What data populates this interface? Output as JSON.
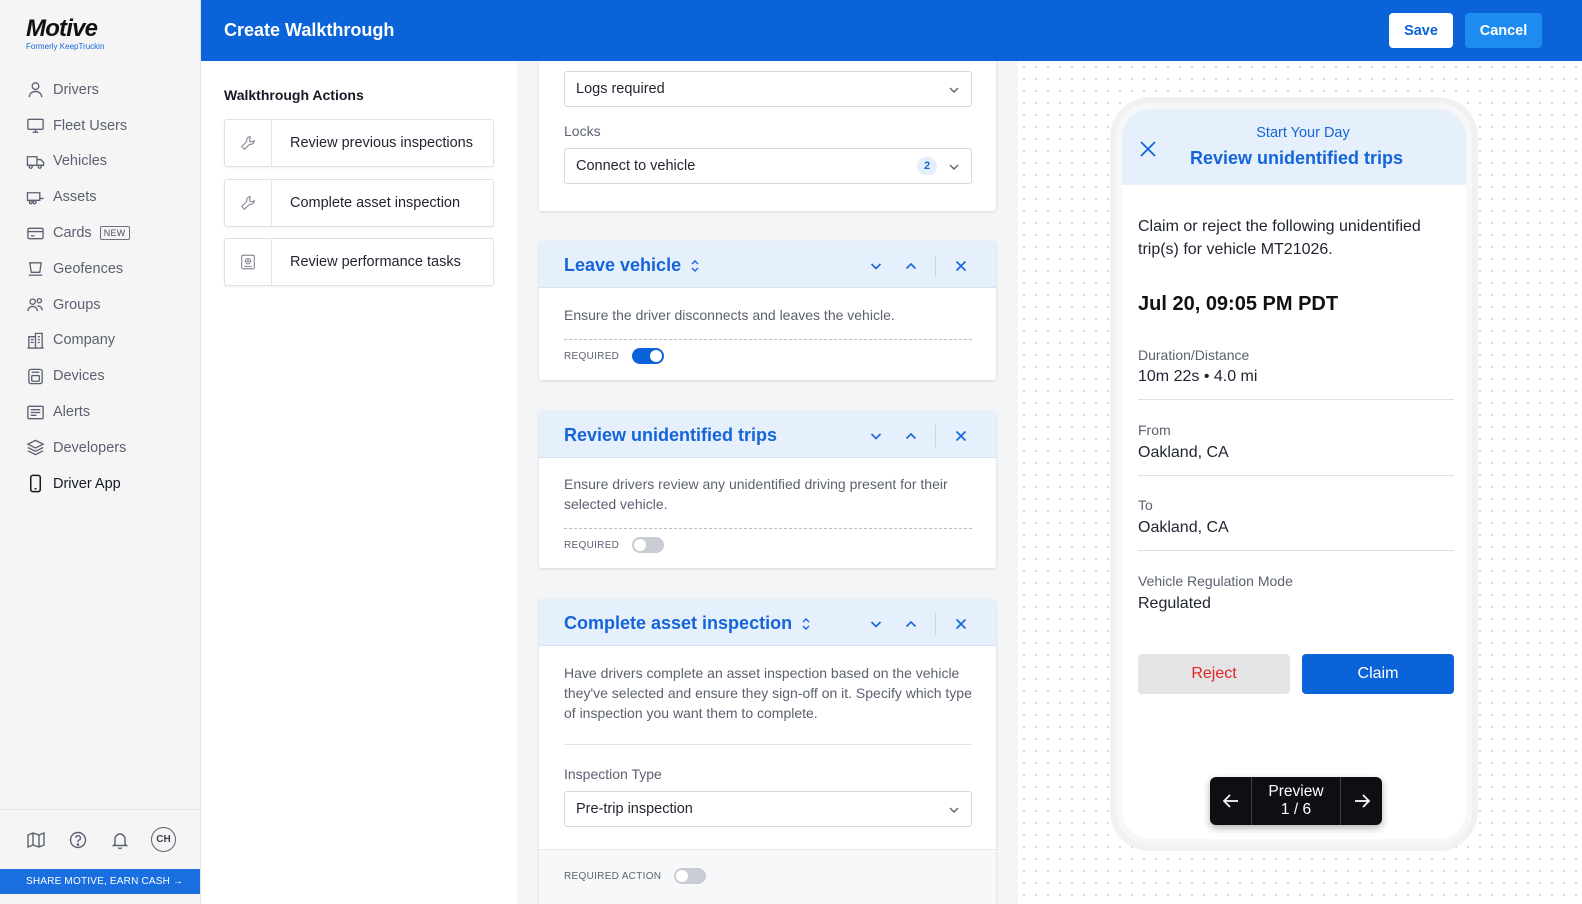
{
  "brand": {
    "name": "Motive",
    "tagline": "Formerly KeepTruckin"
  },
  "sidebar": {
    "items": [
      {
        "label": "Drivers",
        "icon": "person-icon"
      },
      {
        "label": "Fleet Users",
        "icon": "monitor-icon"
      },
      {
        "label": "Vehicles",
        "icon": "truck-icon"
      },
      {
        "label": "Assets",
        "icon": "trailer-icon"
      },
      {
        "label": "Cards",
        "icon": "card-icon",
        "badge": "NEW"
      },
      {
        "label": "Geofences",
        "icon": "map-area-icon"
      },
      {
        "label": "Groups",
        "icon": "groups-icon"
      },
      {
        "label": "Company",
        "icon": "building-icon"
      },
      {
        "label": "Devices",
        "icon": "devices-icon"
      },
      {
        "label": "Alerts",
        "icon": "alerts-icon"
      },
      {
        "label": "Developers",
        "icon": "layers-icon"
      },
      {
        "label": "Driver App",
        "icon": "phone-icon",
        "active": true
      }
    ],
    "share": "SHARE MOTIVE, EARN CASH →",
    "avatar": "CH"
  },
  "header": {
    "title": "Create Walkthrough",
    "save": "Save",
    "cancel": "Cancel"
  },
  "actions": {
    "title": "Walkthrough Actions",
    "items": [
      {
        "label": "Review previous inspections",
        "icon": "wrench-icon"
      },
      {
        "label": "Complete asset inspection",
        "icon": "wrench-icon"
      },
      {
        "label": "Review performance tasks",
        "icon": "target-icon"
      }
    ]
  },
  "editor": {
    "top_card": {
      "logs_select": "Logs required",
      "locks_label": "Locks",
      "locks_select": "Connect to vehicle",
      "locks_count": "2"
    },
    "leave_vehicle": {
      "title": "Leave vehicle",
      "description": "Ensure the driver disconnects and leaves the vehicle.",
      "required_label": "REQUIRED",
      "required": true
    },
    "review_trips": {
      "title": "Review unidentified trips",
      "description": "Ensure drivers review any unidentified driving present for their selected vehicle.",
      "required_label": "REQUIRED",
      "required": false
    },
    "asset_inspection": {
      "title": "Complete asset inspection",
      "description": "Have drivers complete an asset inspection based on the vehicle they've selected and ensure they sign-off on it. Specify which type of inspection you want them to complete.",
      "inspection_type_label": "Inspection Type",
      "inspection_type": "Pre-trip inspection",
      "required_action_label": "REQUIRED ACTION",
      "required_action": false
    }
  },
  "preview": {
    "supertitle": "Start Your Day",
    "title": "Review unidentified trips",
    "description": "Claim or reject the following unidentified trip(s) for vehicle MT21026.",
    "datetime": "Jul 20, 09:05 PM PDT",
    "fields": [
      {
        "label": "Duration/Distance",
        "value": "10m 22s • 4.0 mi"
      },
      {
        "label": "From",
        "value": "Oakland, CA"
      },
      {
        "label": "To",
        "value": "Oakland, CA"
      },
      {
        "label": "Vehicle Regulation Mode",
        "value": "Regulated"
      }
    ],
    "reject": "Reject",
    "claim": "Claim",
    "pager_label": "Preview",
    "pager_count": "1 / 6"
  },
  "colors": {
    "brand_blue": "#0a63d8",
    "reject_red": "#e02424",
    "header_tint": "#e5f0fc"
  }
}
